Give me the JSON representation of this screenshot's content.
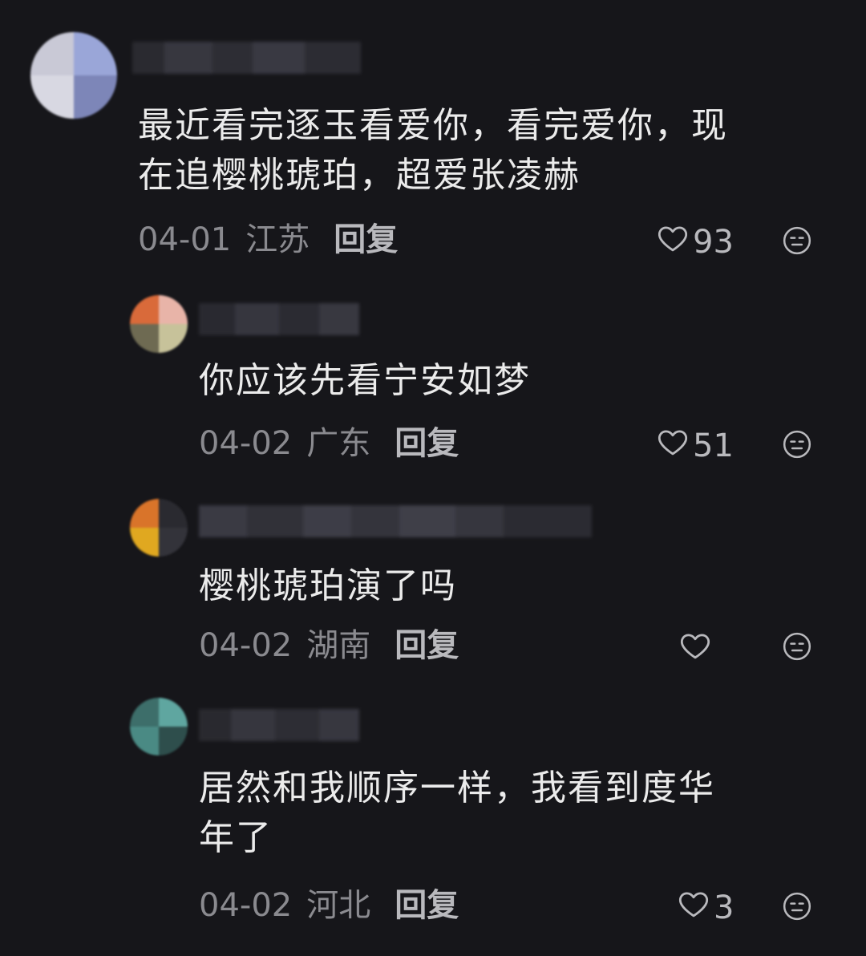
{
  "comments": [
    {
      "text": "最近看完逐玉看爱你，看完爱你，现\n在追樱桃琥珀，超爱张凌赫",
      "date": "04-01",
      "location": "江苏",
      "reply_label": "回复",
      "likes": "93"
    },
    {
      "text": "你应该先看宁安如梦",
      "date": "04-02",
      "location": "广东",
      "reply_label": "回复",
      "likes": "51"
    },
    {
      "text": "樱桃琥珀演了吗",
      "date": "04-02",
      "location": "湖南",
      "reply_label": "回复",
      "likes": ""
    },
    {
      "text": "居然和我顺序一样，我看到度华\n年了",
      "date": "04-02",
      "location": "河北",
      "reply_label": "回复",
      "likes": "3"
    }
  ],
  "icons": {
    "like": "heart-outline-icon",
    "dislike": "meh-face-icon"
  },
  "colors": {
    "background": "#16161a",
    "text": "#ebebeb",
    "meta": "#8a8a8f"
  }
}
